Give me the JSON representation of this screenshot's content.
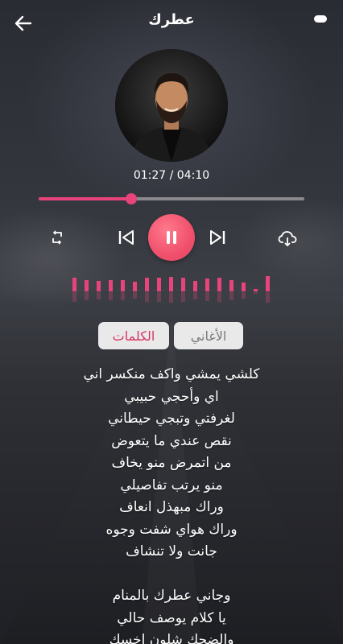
{
  "header": {
    "title": "عطرك"
  },
  "player": {
    "current_time": "01:27",
    "total_time": "04:10",
    "time_display": "01:27 / 04:10",
    "progress": 0.348,
    "state": "playing"
  },
  "visualizer": {
    "levels": [
      0.55,
      0.45,
      0.42,
      0.45,
      0.48,
      0.4,
      0.55,
      0.58,
      0.6,
      0.55,
      0.42,
      0.52,
      0.58,
      0.48,
      0.38,
      0.08,
      0.62
    ]
  },
  "tabs": {
    "lyrics_label": "الكلمات",
    "songs_label": "الأغاني",
    "active": "lyrics"
  },
  "lyrics": [
    "كلشي يمشي واكف منكسر اني",
    "اي وأحجي حبيبي",
    "لغرفتي وتبجي حيطاني",
    "نقص عندي ما يتعوض",
    "من اتمرض منو يخاف",
    "منو يرتب تفاصيلي",
    "وراك مبهذل انعاف",
    "وراك هواي شفت وجوه",
    "جانت ولا تنشاف",
    "",
    "وجاني عطرك بالمنام",
    "يا كلام يوصف حالي",
    "والضحك شلون اخسك"
  ],
  "colors": {
    "accent": "#e8437a",
    "play_button": "#f0506c",
    "tab_bg": "#e9e9ea",
    "active_tab_text": "#d6335f",
    "inactive_tab_text": "#7a7a7a"
  },
  "icons": {
    "back": "arrow-left-icon",
    "menu": "menu-pill-icon",
    "repeat": "repeat-icon",
    "prev": "skip-previous-icon",
    "pause": "pause-icon",
    "next": "skip-next-icon",
    "download": "cloud-download-icon"
  }
}
